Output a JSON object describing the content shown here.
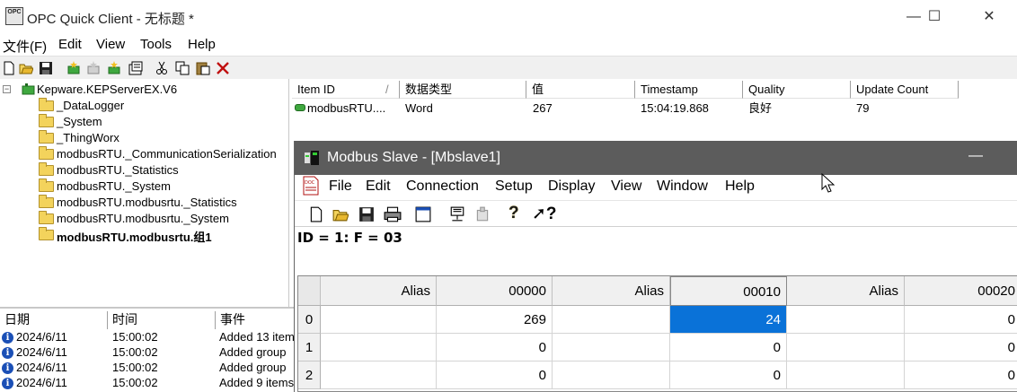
{
  "opc": {
    "app_icon_text": "OPC",
    "title": "OPC Quick Client - 无标题 *",
    "menu": [
      "文件(F)",
      "Edit",
      "View",
      "Tools",
      "Help"
    ],
    "tree": {
      "root": "Kepware.KEPServerEX.V6",
      "items": [
        "_DataLogger",
        "_System",
        "_ThingWorx",
        "modbusRTU._CommunicationSerialization",
        "modbusRTU._Statistics",
        "modbusRTU._System",
        "modbusRTU.modbusrtu._Statistics",
        "modbusRTU.modbusrtu._System",
        "modbusRTU.modbusrtu.组1"
      ]
    },
    "list": {
      "columns": [
        "Item ID",
        "数据类型",
        "值",
        "Timestamp",
        "Quality",
        "Update Count"
      ],
      "rows": [
        {
          "item_id": "modbusRTU....",
          "type": "Word",
          "value": "267",
          "timestamp": "15:04:19.868",
          "quality": "良好",
          "update_count": "79"
        }
      ]
    },
    "events": {
      "columns": [
        "日期",
        "时间",
        "事件"
      ],
      "rows": [
        {
          "date": "2024/6/11",
          "time": "15:00:02",
          "event": "Added 13 item"
        },
        {
          "date": "2024/6/11",
          "time": "15:00:02",
          "event": "Added group"
        },
        {
          "date": "2024/6/11",
          "time": "15:00:02",
          "event": "Added group"
        },
        {
          "date": "2024/6/11",
          "time": "15:00:02",
          "event": "Added 9 items"
        }
      ]
    }
  },
  "modbus": {
    "title": "Modbus Slave - [Mbslave1]",
    "menu": [
      "File",
      "Edit",
      "Connection",
      "Setup",
      "Display",
      "View",
      "Window",
      "Help"
    ],
    "status": "ID = 1: F = 03",
    "grid": {
      "headers": [
        "Alias",
        "00000",
        "Alias",
        "00010",
        "Alias",
        "00020"
      ],
      "rows": [
        {
          "index": "0",
          "c1": "269",
          "c2": "24",
          "c3": "0"
        },
        {
          "index": "1",
          "c1": "0",
          "c2": "0",
          "c3": "0"
        },
        {
          "index": "2",
          "c1": "0",
          "c2": "0",
          "c3": "0"
        }
      ]
    },
    "selected_color": "#0a72d8"
  },
  "icons": {
    "opc_toolbar": [
      "new-icon",
      "open-icon",
      "save-icon",
      "new-server-icon",
      "new-group-icon",
      "new-item-icon",
      "properties-icon",
      "cut-icon",
      "copy-icon",
      "paste-icon",
      "delete-icon"
    ],
    "modbus_toolbar": [
      "new-icon",
      "open-icon",
      "save-icon",
      "print-icon",
      "window-icon",
      "connect-icon",
      "disconnect-icon",
      "help-icon",
      "context-help-icon"
    ]
  }
}
